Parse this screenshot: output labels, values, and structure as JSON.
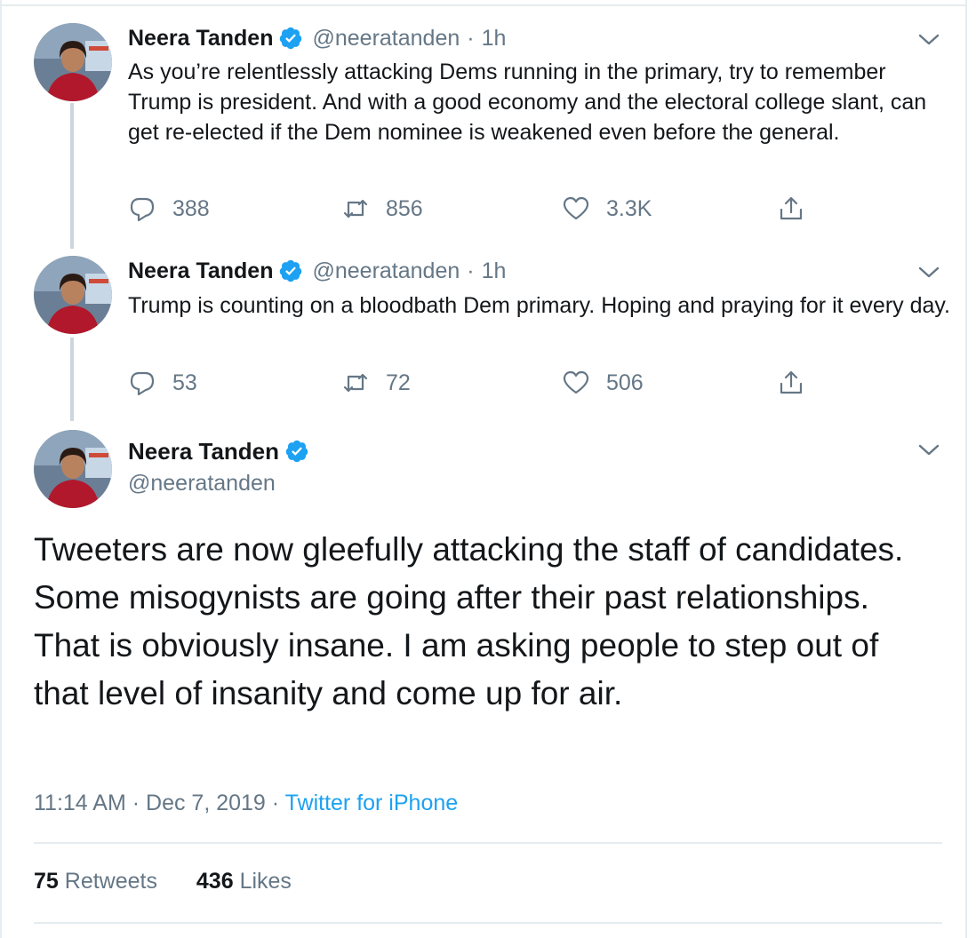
{
  "tweets": [
    {
      "name": "Neera Tanden",
      "handle": "@neeratanden",
      "separator": "·",
      "time": "1h",
      "text": "As you’re relentlessly attacking Dems running in the primary, try to remember Trump is president. And with a good economy and the electoral college slant, can get re-elected if the Dem nominee is weakened even before the general.",
      "replies": "388",
      "retweets": "856",
      "likes": "3.3K"
    },
    {
      "name": "Neera Tanden",
      "handle": "@neeratanden",
      "separator": "·",
      "time": "1h",
      "text": "Trump is counting on a bloodbath Dem primary. Hoping and praying for it every day.",
      "replies": "53",
      "retweets": "72",
      "likes": "506"
    }
  ],
  "main_tweet": {
    "name": "Neera Tanden",
    "handle": "@neeratanden",
    "text": "Tweeters are now gleefully attacking the staff of candidates. Some misogynists are going after their past relationships. That is obviously insane. I am asking people to step out of that level of insanity and come up for air.",
    "time": "11:14 AM",
    "separator": "·",
    "date": "Dec 7, 2019",
    "source": "Twitter for iPhone",
    "retweet_count": "75",
    "retweet_label": "Retweets",
    "like_count": "436",
    "like_label": "Likes"
  },
  "icons": {
    "verified": "verified-badge-icon",
    "reply": "reply-icon",
    "retweet": "retweet-icon",
    "like": "heart-icon",
    "share": "share-icon",
    "menu": "chevron-down-icon"
  },
  "colors": {
    "accent": "#1da1f2",
    "text": "#14171a",
    "muted": "#657786",
    "line": "#ccd6dd"
  }
}
